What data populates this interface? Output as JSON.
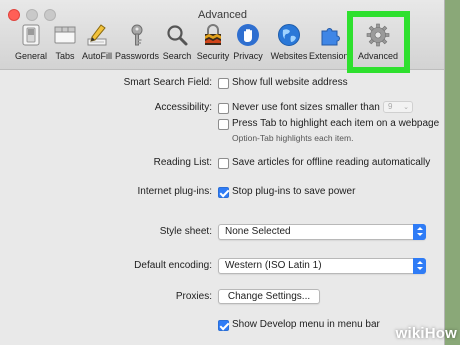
{
  "window": {
    "title": "Advanced"
  },
  "toolbar": {
    "items": [
      {
        "label": "General",
        "icon": "general-switch-icon"
      },
      {
        "label": "Tabs",
        "icon": "tabs-icon"
      },
      {
        "label": "AutoFill",
        "icon": "autofill-pencil-icon"
      },
      {
        "label": "Passwords",
        "icon": "key-icon"
      },
      {
        "label": "Search",
        "icon": "magnifier-icon"
      },
      {
        "label": "Security",
        "icon": "padlock-icon"
      },
      {
        "label": "Privacy",
        "icon": "hand-icon"
      },
      {
        "label": "Websites",
        "icon": "globe-icon"
      },
      {
        "label": "Extensions",
        "icon": "puzzle-icon"
      },
      {
        "label": "Advanced",
        "icon": "gear-icon"
      }
    ],
    "highlight_color": "#2ee02e"
  },
  "settings": {
    "smart_search": {
      "label": "Smart Search Field:",
      "option": "Show full website address",
      "checked": false
    },
    "accessibility": {
      "label": "Accessibility:",
      "font_option": "Never use font sizes smaller than",
      "font_size": "9",
      "tab_option": "Press Tab to highlight each item on a webpage",
      "tab_note": "Option-Tab highlights each item."
    },
    "reading_list": {
      "label": "Reading List:",
      "option": "Save articles for offline reading automatically"
    },
    "plugins": {
      "label": "Internet plug-ins:",
      "option": "Stop plug-ins to save power",
      "checked": true
    },
    "style_sheet": {
      "label": "Style sheet:",
      "value": "None Selected"
    },
    "encoding": {
      "label": "Default encoding:",
      "value": "Western (ISO Latin 1)"
    },
    "proxies": {
      "label": "Proxies:",
      "button": "Change Settings..."
    },
    "develop": {
      "option": "Show Develop menu in menu bar",
      "checked": true
    }
  },
  "watermark": {
    "prefix": "wiki",
    "suffix": "How"
  },
  "colors": {
    "accent": "#2f7cf6",
    "window_bg": "#e9e9e9",
    "page_bg": "#8aa878"
  }
}
